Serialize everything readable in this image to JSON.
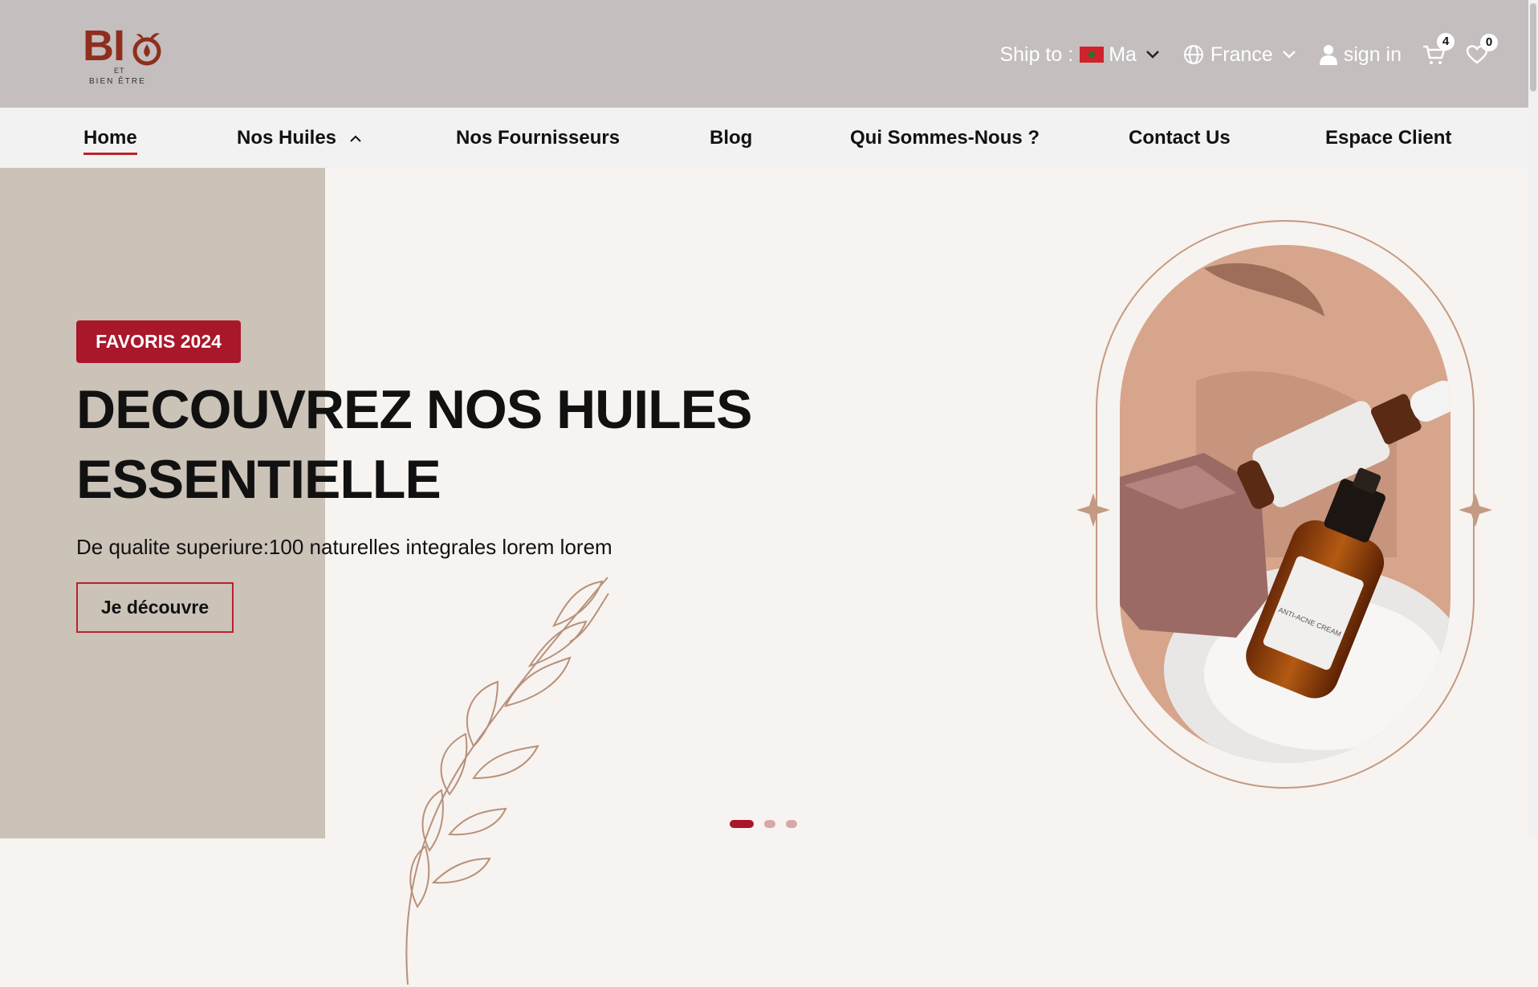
{
  "brand": {
    "big": "BI",
    "small1": "ET",
    "small2": "BIEN ÊTRE",
    "color": "#8f2e1e"
  },
  "header": {
    "ship_label": "Ship to :",
    "ship_country": "Ma",
    "language": "France",
    "sign_in": "sign in",
    "cart_count": "4",
    "wishlist_count": "0"
  },
  "nav": {
    "items": [
      "Home",
      "Nos Huiles",
      "Nos Fournisseurs",
      "Blog",
      "Qui Sommes-Nous ?",
      "Contact Us",
      "Espace Client"
    ],
    "active": "Home"
  },
  "hero": {
    "tag": "FAVORIS 2024",
    "headline_line1": "DECOUVREZ NOS HUILES",
    "headline_line2": "ESSENTIELLE",
    "subtitle": "De qualite superiure:100 naturelles integrales lorem lorem",
    "cta": "Je découvre",
    "bottle_label": "ANTI-ACNE CREAM",
    "slides": 3,
    "active_slide": 1
  },
  "colors": {
    "accent": "#a9172a",
    "header_bg": "#c4bebe",
    "hero_bg": "#f7f3f0",
    "side_panel": "#cbc2b8"
  }
}
